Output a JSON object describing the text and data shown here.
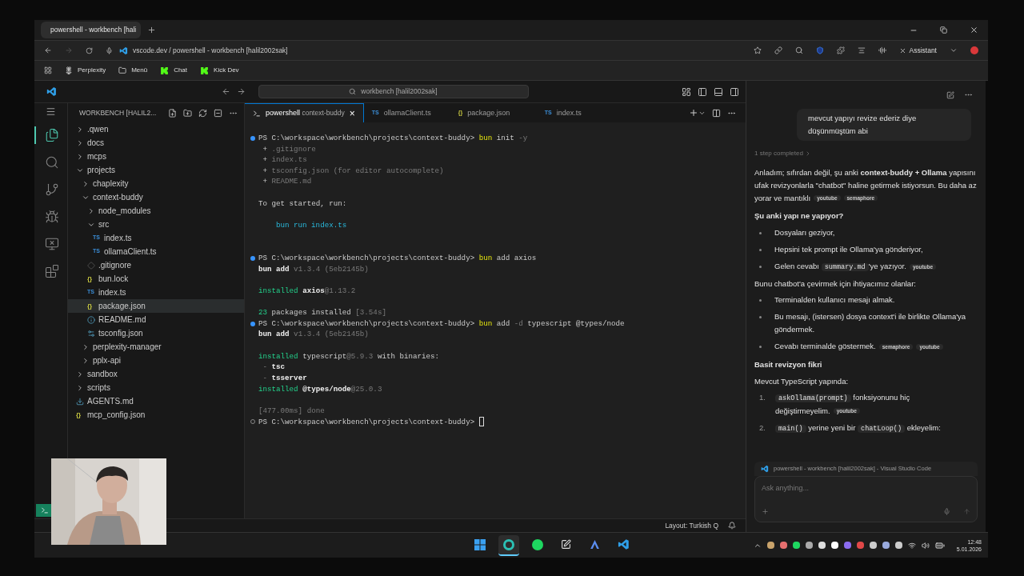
{
  "browser": {
    "tab": {
      "title": "powershell - workbench [hali",
      "selected": true
    },
    "address": "vscode.dev / powershell - workbench [halil2002sak]",
    "assistant": "Assistant",
    "bookmarks": [
      {
        "kind": "perplexity",
        "label": "Perplexity"
      },
      {
        "kind": "folder",
        "label": "Menü"
      },
      {
        "kind": "kick",
        "label": "Chat"
      },
      {
        "kind": "kick",
        "label": "Kick Dev"
      }
    ]
  },
  "vscode": {
    "command_center": "workbench [halil2002sak]",
    "activity": [
      {
        "kind": "files",
        "selected": true
      },
      {
        "kind": "search",
        "selected": false
      },
      {
        "kind": "scm",
        "selected": false
      },
      {
        "kind": "debug",
        "selected": false
      },
      {
        "kind": "remote",
        "selected": false
      },
      {
        "kind": "extensions",
        "selected": false
      }
    ],
    "explorer": {
      "title": "WORKBENCH [HALIL2...",
      "tree": [
        {
          "name": ".qwen",
          "kind": "folder",
          "expanded": false
        },
        {
          "name": "docs",
          "kind": "folder",
          "expanded": false
        },
        {
          "name": "mcps",
          "kind": "folder",
          "expanded": false
        },
        {
          "name": "projects",
          "kind": "folder",
          "expanded": true,
          "children": [
            {
              "name": "chaplexity",
              "kind": "folder",
              "expanded": false
            },
            {
              "name": "context-buddy",
              "kind": "folder",
              "expanded": true,
              "children": [
                {
                  "name": "node_modules",
                  "kind": "folder",
                  "expanded": false
                },
                {
                  "name": "src",
                  "kind": "folder",
                  "expanded": true,
                  "children": [
                    {
                      "name": "index.ts",
                      "kind": "ts",
                      "badge": "TS",
                      "selected": false
                    },
                    {
                      "name": "ollamaClient.ts",
                      "kind": "ts",
                      "badge": "TS",
                      "selected": false
                    }
                  ]
                },
                {
                  "name": ".gitignore",
                  "kind": "git",
                  "selected": false
                },
                {
                  "name": "bun.lock",
                  "kind": "json",
                  "badge": "{}",
                  "selected": false
                },
                {
                  "name": "index.ts",
                  "kind": "ts",
                  "badge": "TS",
                  "selected": false
                },
                {
                  "name": "package.json",
                  "kind": "json",
                  "badge": "{}",
                  "selected": true
                },
                {
                  "name": "README.md",
                  "kind": "info",
                  "selected": false
                },
                {
                  "name": "tsconfig.json",
                  "kind": "config",
                  "selected": false
                }
              ]
            },
            {
              "name": "perplexity-manager",
              "kind": "folder",
              "expanded": false
            },
            {
              "name": "pplx-api",
              "kind": "folder",
              "expanded": false
            }
          ]
        },
        {
          "name": "sandbox",
          "kind": "folder",
          "expanded": false
        },
        {
          "name": "scripts",
          "kind": "folder",
          "expanded": false
        },
        {
          "name": "AGENTS.md",
          "kind": "download",
          "selected": false
        },
        {
          "name": "mcp_config.json",
          "kind": "json",
          "badge": "{}",
          "selected": false
        }
      ]
    },
    "tabs": [
      {
        "kind": "terminal",
        "label": "powershell",
        "detail": "context-buddy",
        "selected": true,
        "close": "×"
      },
      {
        "kind": "file",
        "badge": "TS",
        "label": "ollamaClient.ts",
        "selected": false
      },
      {
        "kind": "json",
        "badge": "{}",
        "label": "package.json",
        "selected": false
      },
      {
        "kind": "file",
        "badge": "TS",
        "label": "index.ts",
        "selected": false
      }
    ],
    "terminal": [
      {
        "kind": "done-prompt",
        "parts": [
          {
            "t": "PS C:\\workspace\\workbench\\projects\\context-buddy> ",
            "kind": "plain"
          },
          {
            "t": "bun",
            "kind": "yellow"
          },
          {
            "t": " init",
            "kind": "plain"
          },
          {
            "t": " -y",
            "kind": "dim"
          }
        ]
      },
      {
        "kind": "line",
        "parts": [
          {
            "t": " + ",
            "kind": "plain"
          },
          {
            "t": ".gitignore",
            "kind": "dim"
          }
        ]
      },
      {
        "kind": "line",
        "parts": [
          {
            "t": " + ",
            "kind": "plain"
          },
          {
            "t": "index.ts",
            "kind": "dim"
          }
        ]
      },
      {
        "kind": "line",
        "parts": [
          {
            "t": " + ",
            "kind": "plain"
          },
          {
            "t": "tsconfig.json (for editor autocomplete)",
            "kind": "dim"
          }
        ]
      },
      {
        "kind": "line",
        "parts": [
          {
            "t": " + ",
            "kind": "plain"
          },
          {
            "t": "README.md",
            "kind": "dim"
          }
        ]
      },
      {
        "kind": "blank"
      },
      {
        "kind": "line",
        "parts": [
          {
            "t": "To get started, run:",
            "kind": "plain"
          }
        ]
      },
      {
        "kind": "blank"
      },
      {
        "kind": "indented",
        "parts": [
          {
            "t": "bun run index.ts",
            "kind": "cyan"
          }
        ]
      },
      {
        "kind": "blank"
      },
      {
        "kind": "blank"
      },
      {
        "kind": "done-prompt",
        "parts": [
          {
            "t": "PS C:\\workspace\\workbench\\projects\\context-buddy> ",
            "kind": "plain"
          },
          {
            "t": "bun",
            "kind": "yellow"
          },
          {
            "t": " add axios",
            "kind": "plain"
          }
        ]
      },
      {
        "kind": "line",
        "parts": [
          {
            "t": "bun add",
            "kind": "bold"
          },
          {
            "t": " v1.3.4 (5eb2145b)",
            "kind": "dim"
          }
        ]
      },
      {
        "kind": "blank"
      },
      {
        "kind": "line",
        "parts": [
          {
            "t": "installed",
            "kind": "green"
          },
          {
            "t": " axios",
            "kind": "bold"
          },
          {
            "t": "@1.13.2",
            "kind": "dim"
          }
        ]
      },
      {
        "kind": "blank"
      },
      {
        "kind": "line",
        "parts": [
          {
            "t": "23",
            "kind": "green"
          },
          {
            "t": " packages installed ",
            "kind": "plain"
          },
          {
            "t": "[3.54s]",
            "kind": "dim"
          }
        ]
      },
      {
        "kind": "done-prompt",
        "parts": [
          {
            "t": "PS C:\\workspace\\workbench\\projects\\context-buddy> ",
            "kind": "plain"
          },
          {
            "t": "bun",
            "kind": "yellow"
          },
          {
            "t": " add",
            "kind": "plain"
          },
          {
            "t": " -d",
            "kind": "dim"
          },
          {
            "t": " typescript @types/node",
            "kind": "plain"
          }
        ]
      },
      {
        "kind": "line",
        "parts": [
          {
            "t": "bun add",
            "kind": "bold"
          },
          {
            "t": " v1.3.4 (5eb2145b)",
            "kind": "dim"
          }
        ]
      },
      {
        "kind": "blank"
      },
      {
        "kind": "line",
        "parts": [
          {
            "t": "installed",
            "kind": "green"
          },
          {
            "t": " typescript",
            "kind": "plain"
          },
          {
            "t": "@5.9.3",
            "kind": "dim"
          },
          {
            "t": " with binaries:",
            "kind": "plain"
          }
        ]
      },
      {
        "kind": "line",
        "parts": [
          {
            "t": " - ",
            "kind": "dim"
          },
          {
            "t": "tsc",
            "kind": "bold"
          }
        ]
      },
      {
        "kind": "line",
        "parts": [
          {
            "t": " - ",
            "kind": "dim"
          },
          {
            "t": "tsserver",
            "kind": "bold"
          }
        ]
      },
      {
        "kind": "line",
        "parts": [
          {
            "t": "installed",
            "kind": "green"
          },
          {
            "t": " @types/node",
            "kind": "bold"
          },
          {
            "t": "@25.0.3",
            "kind": "dim"
          }
        ]
      },
      {
        "kind": "blank"
      },
      {
        "kind": "line",
        "parts": [
          {
            "t": "[477.00ms] done",
            "kind": "dim"
          }
        ]
      },
      {
        "kind": "pending-prompt",
        "cursor": true,
        "parts": [
          {
            "t": "PS C:\\workspace\\workbench\\projects\\context-buddy> ",
            "kind": "plain"
          }
        ]
      }
    ],
    "status": {
      "layout": "Layout: Turkish Q"
    }
  },
  "assistant": {
    "user_message": "mevcut yapıyı revize ederiz diye düşünmüştüm abi",
    "steps": "1 step completed",
    "blocks": [
      {
        "kind": "paragraph",
        "text": "Anladım; sıfırdan değil, şu anki **context-buddy + Ollama** yapısını ufak revizyonlarla \"chatbot\" haline getirmek istiyorsun. Bu daha az yorar ve mantıklı",
        "sources": [
          "youtube",
          "semaphore"
        ]
      },
      {
        "kind": "heading",
        "text": "Şu anki yapı ne yapıyor?"
      },
      {
        "kind": "bullets",
        "items": [
          {
            "parts": [
              {
                "kind": "text",
                "text": "Dosyaları geziyor,"
              }
            ]
          },
          {
            "parts": [
              {
                "kind": "text",
                "text": "Hepsini tek prompt ile Ollama'ya gönderiyor,"
              }
            ]
          },
          {
            "parts": [
              {
                "kind": "text",
                "text": "Gelen cevabı "
              },
              {
                "kind": "code",
                "text": "summary.md"
              },
              {
                "kind": "text",
                "text": "'ye yazıyor."
              }
            ],
            "sources": [
              "youtube"
            ]
          }
        ]
      },
      {
        "kind": "paragraph",
        "text": "Bunu chatbot'a çevirmek için ihtiyacımız olanlar:"
      },
      {
        "kind": "bullets",
        "items": [
          {
            "parts": [
              {
                "kind": "text",
                "text": "Terminalden kullanıcı mesajı almak."
              }
            ]
          },
          {
            "parts": [
              {
                "kind": "text",
                "text": "Bu mesajı, (istersen) dosya context'i ile birlikte Ollama'ya göndermek."
              }
            ]
          },
          {
            "parts": [
              {
                "kind": "text",
                "text": "Cevabı terminalde göstermek."
              }
            ],
            "sources": [
              "semaphore",
              "youtube"
            ]
          }
        ]
      },
      {
        "kind": "heading",
        "text": "Basit revizyon fikri"
      },
      {
        "kind": "paragraph",
        "text": "Mevcut TypeScript yapında:"
      },
      {
        "kind": "numbered",
        "items": [
          {
            "marker": "1.",
            "parts": [
              {
                "kind": "code",
                "text": "askOllama(prompt)"
              },
              {
                "kind": "text",
                "text": " fonksiyonunu hiç değiştirmeyelim."
              }
            ],
            "sources": [
              "youtube"
            ]
          },
          {
            "marker": "2.",
            "parts": [
              {
                "kind": "code",
                "text": "main()"
              },
              {
                "kind": "text",
                "text": " yerine yeni bir "
              },
              {
                "kind": "code",
                "text": "chatLoop()"
              },
              {
                "kind": "text",
                "text": " ekleyelim:"
              }
            ]
          }
        ]
      }
    ],
    "context": "powershell - workbench [halil2002sak] - Visual Studio Code",
    "placeholder": "Ask anything..."
  },
  "taskbar": {
    "apps": [
      {
        "kind": "start",
        "selected": false
      },
      {
        "kind": "browser",
        "selected": true
      },
      {
        "kind": "spotify",
        "selected": false
      },
      {
        "kind": "notes",
        "selected": false
      },
      {
        "kind": "arc",
        "selected": false
      },
      {
        "kind": "vscode",
        "selected": false
      }
    ],
    "time": "12:48",
    "date": "5.01.2026"
  }
}
